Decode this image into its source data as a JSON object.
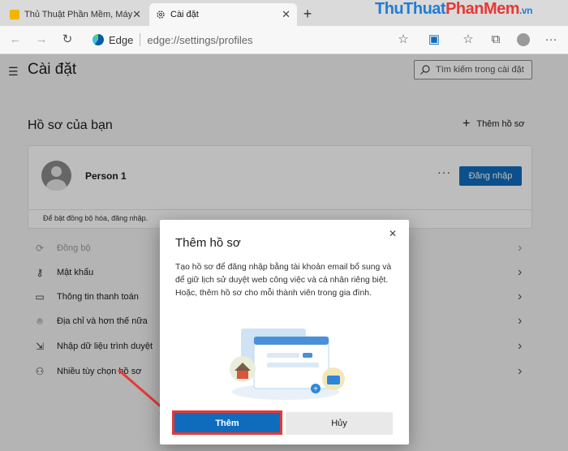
{
  "tabs": [
    {
      "title": "Thủ Thuật Phần Mềm, Máy Tính,",
      "close": "✕"
    },
    {
      "title": "Cài đặt",
      "close": "✕"
    }
  ],
  "new_tab": "+",
  "address_bar": {
    "site": "Edge",
    "url": "edge://settings/profiles"
  },
  "watermark": {
    "part1": "ThuThuat",
    "part2": "PhanMem",
    "part3": ".vn"
  },
  "settings": {
    "title": "Cài đặt",
    "search_placeholder": "Tìm kiếm trong cài đặt",
    "section_title": "Hồ sơ của bạn",
    "add_profile_label": "Thêm hồ sơ",
    "profile": {
      "name": "Person 1",
      "more": "···",
      "signin_label": "Đăng nhập",
      "sync_hint": "Để bật đồng bộ hóa, đăng nhập."
    },
    "rows": [
      {
        "label": "Đồng bộ",
        "icon": "sync-icon",
        "disabled": true
      },
      {
        "label": "Mật khẩu",
        "icon": "key-icon",
        "disabled": false
      },
      {
        "label": "Thông tin thanh toán",
        "icon": "card-icon",
        "disabled": false
      },
      {
        "label": "Địa chỉ và hơn thế nữa",
        "icon": "location-icon",
        "disabled": false
      },
      {
        "label": "Nhập dữ liệu trình duyệt",
        "icon": "import-icon",
        "disabled": false
      },
      {
        "label": "Nhiều tùy chọn hồ sơ",
        "icon": "people-icon",
        "disabled": false
      }
    ]
  },
  "dialog": {
    "title": "Thêm hồ sơ",
    "body": "Tạo hồ sơ để đăng nhập bằng tài khoản email bổ sung và để giữ lịch sử duyệt web công việc và cá nhân riêng biệt. Hoặc, thêm hồ sơ cho mỗi thành viên trong gia đình.",
    "add_label": "Thêm",
    "cancel_label": "Hủy"
  },
  "colors": {
    "accent": "#0f6cbd",
    "highlight": "#e53935"
  }
}
